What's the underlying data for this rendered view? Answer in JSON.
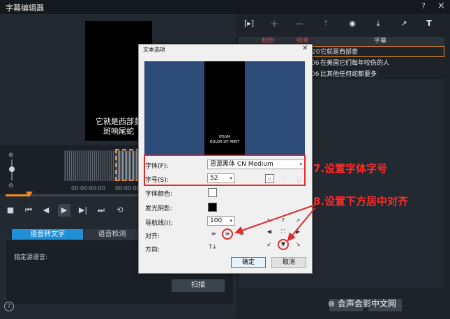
{
  "window": {
    "title": "字幕编辑器",
    "help_glyph": "?",
    "close_glyph": "×"
  },
  "preview": {
    "subtitle_line1": "它就是西部菱",
    "subtitle_line2": "斑响尾蛇"
  },
  "timeline": {
    "timecode_left": "00:00:00:00",
    "timecode_right": "00:00:00:1"
  },
  "transport": {
    "stop": "■",
    "prev": "⏮",
    "back": "◀",
    "play": "▶",
    "fwd": "▶|",
    "next": "⏭",
    "loop": "⟲"
  },
  "left_tabs": {
    "speech_to_text": "语音转文字",
    "voice_detect": "语音检测"
  },
  "left_panel": {
    "source_language_label": "指定源语言:",
    "scan_button": "扫描"
  },
  "right_toolbar": {
    "icons": [
      "import-icon",
      "add-icon",
      "remove-icon",
      "join-icon",
      "preview-icon",
      "export-icon",
      "edit-icon",
      "text-icon"
    ]
  },
  "subtitle_list": {
    "headers": {
      "start": "起始",
      "end": "结束",
      "subtitle": "字幕"
    },
    "rows": [
      {
        "time_tail": "20",
        "text": "它就是西部菱"
      },
      {
        "time_tail": "06",
        "text": "在美国它们每年咬伤的人"
      },
      {
        "time_tail": "06",
        "text": "比其他任何蛇都要多"
      }
    ]
  },
  "dialog": {
    "title": "文本选项",
    "preview_text_line1": "IPSUM",
    "preview_text_line2": "DOLOR SIT AMET",
    "font_label": "字体(F):",
    "font_value": "思源黑体 CN Medium",
    "size_label": "字号(S):",
    "size_value": "52",
    "bold": "B",
    "italic": "I",
    "underline": "U",
    "font_color_label": "字体颜色:",
    "shadow_label": "发光阴影:",
    "guide_label": "导航线(I):",
    "guide_value": "100",
    "align_label": "对齐:",
    "direction_label": "方向:",
    "ok": "确定",
    "cancel": "取消",
    "colors": {
      "font_color": "#ffffff",
      "shadow_color": "#000000"
    }
  },
  "annotations": {
    "step7": "7.设置字体字号",
    "step8": "8.设置下方居中对齐",
    "accent_color": "#e02b2b"
  },
  "watermark": "会声会影中文网"
}
